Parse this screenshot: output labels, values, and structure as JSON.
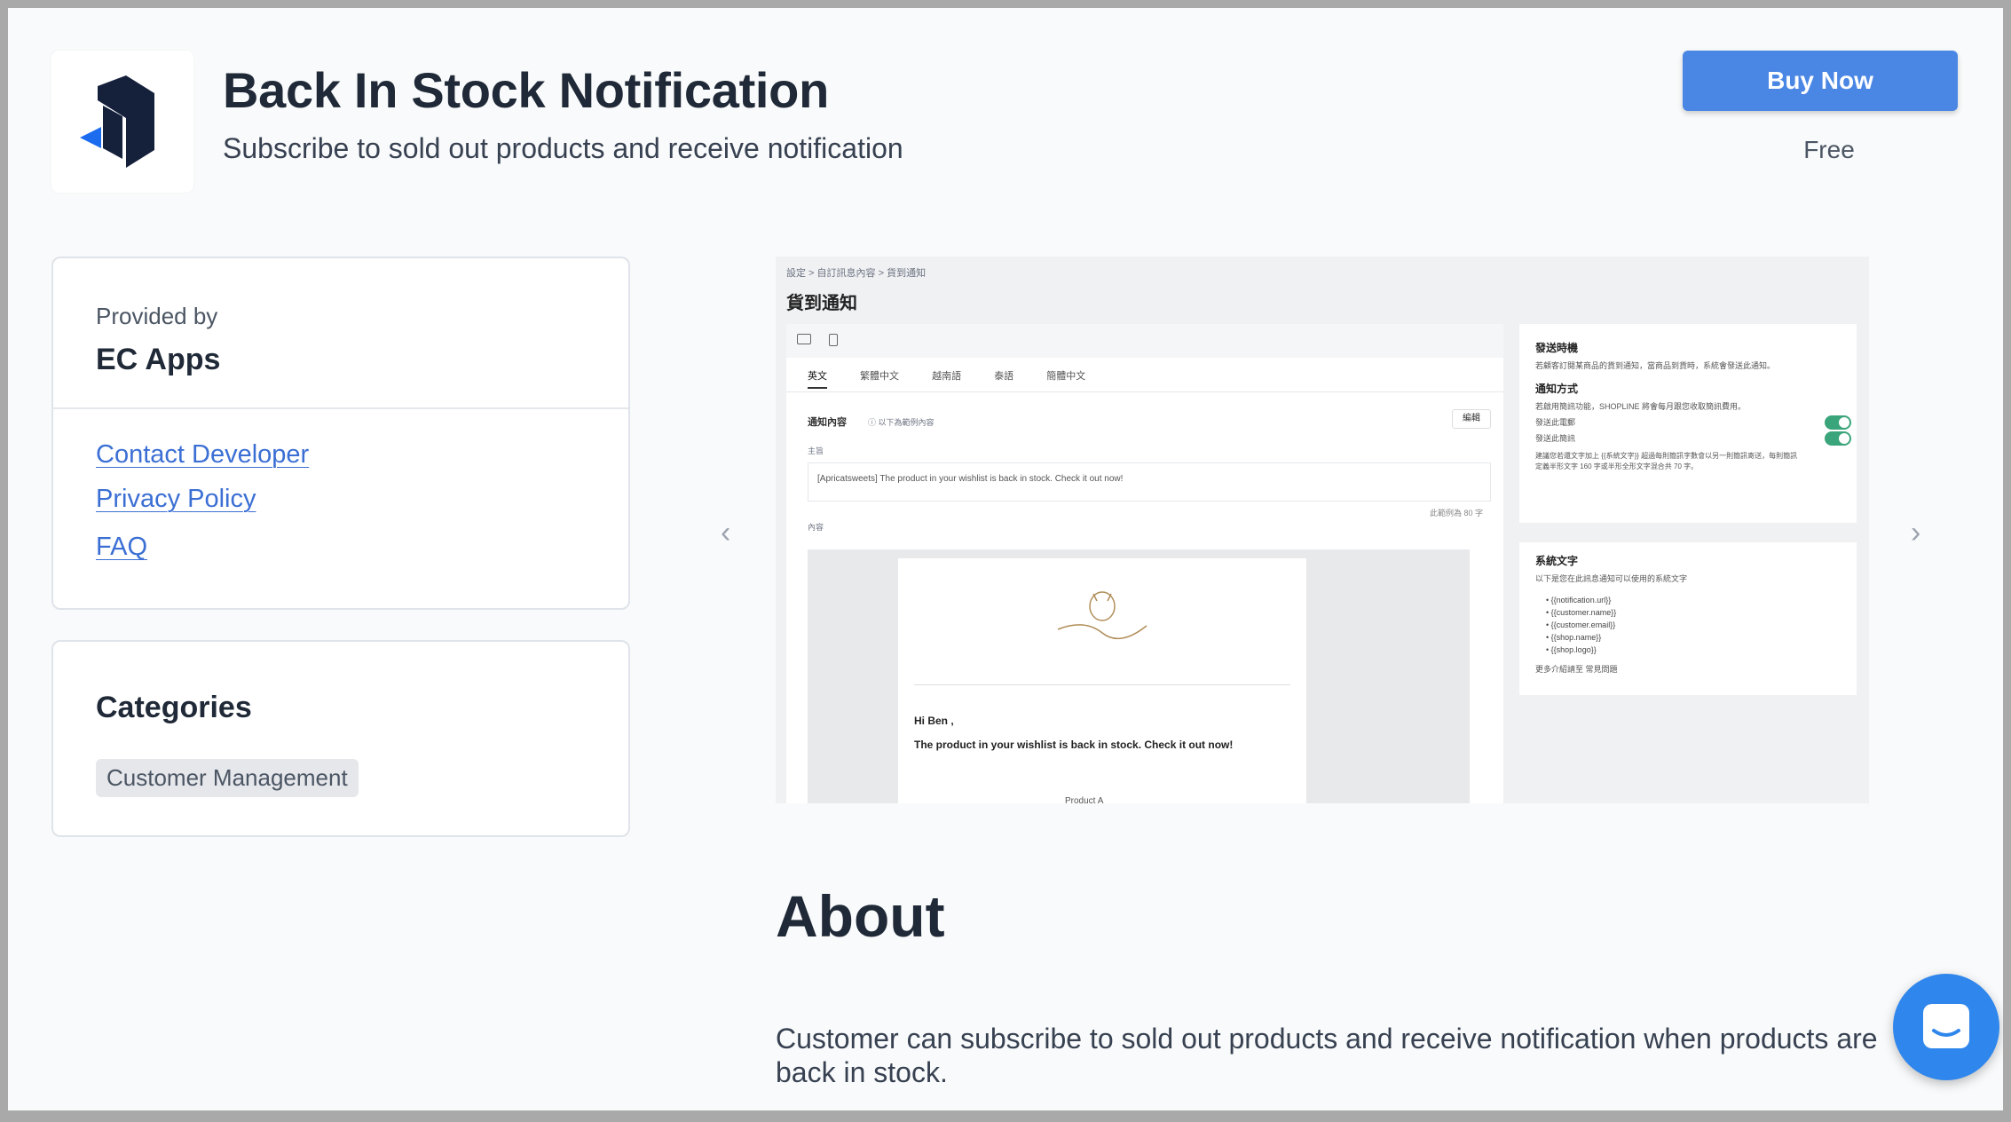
{
  "header": {
    "title": "Back In Stock Notification",
    "subtitle": "Subscribe to sold out products and receive notification",
    "buy_label": "Buy Now",
    "price": "Free"
  },
  "provider": {
    "label": "Provided by",
    "name": "EC Apps",
    "links": [
      "Contact Developer",
      "Privacy Policy",
      "FAQ"
    ]
  },
  "categories": {
    "title": "Categories",
    "tags": [
      "Customer Management"
    ]
  },
  "carousel": {
    "prev_icon": "chevron-left-icon",
    "next_icon": "chevron-right-icon",
    "screenshot": {
      "breadcrumb": "設定 > 自訂訊息內容 > 貨到通知",
      "page_title": "貨到通知",
      "lang_tabs": [
        "英文",
        "繁體中文",
        "越南語",
        "泰語",
        "簡體中文"
      ],
      "content_label": "通知內容",
      "content_hint": "ⓘ 以下為範例內容",
      "edit_label": "編輯",
      "subject_label": "主旨",
      "subject_value": "[Apricatsweets] The product in your wishlist is back in stock. Check it out now!",
      "char_count": "此範例為 80 字",
      "body_label": "內容",
      "email_greeting": "Hi Ben ,",
      "email_body": "The product in your wishlist is back in stock. Check it out now!",
      "email_product": "Product A",
      "timing_title": "發送時機",
      "timing_text": "若顧客訂閱某商品的貨到通知，當商品到貨時，系統會發送此通知。",
      "method_title": "通知方式",
      "method_text": "若啟用簡訊功能，SHOPLINE 將會每月跟您收取簡訊費用。",
      "method_email": "發送此電郵",
      "method_sms": "發送此簡訊",
      "sms_note_1": "建議您若還文字加上 {{系統文字}} 超過每則簡訊字數會以另一則簡訊寄送，每則簡訊",
      "sms_note_2": "定義半形文字 160 字或半形全形文字混合共 70 字。",
      "system_title": "系統文字",
      "system_text": "以下是您在此訊息通知可以使用的系統文字",
      "variables": [
        "{{notification.url}}",
        "{{customer.name}}",
        "{{customer.email}}",
        "{{shop.name}}",
        "{{shop.logo}}"
      ],
      "more_info": "更多介紹請至 常見問題"
    }
  },
  "about": {
    "title": "About",
    "body": "Customer can subscribe to sold out products and receive notification when products are back in stock."
  },
  "colors": {
    "accent": "#4a86e4",
    "link": "#3b6fd4",
    "chat": "#2f86ec",
    "toggle_on": "#3aa57a"
  },
  "chat": {
    "icon": "chat-bubble-icon"
  }
}
